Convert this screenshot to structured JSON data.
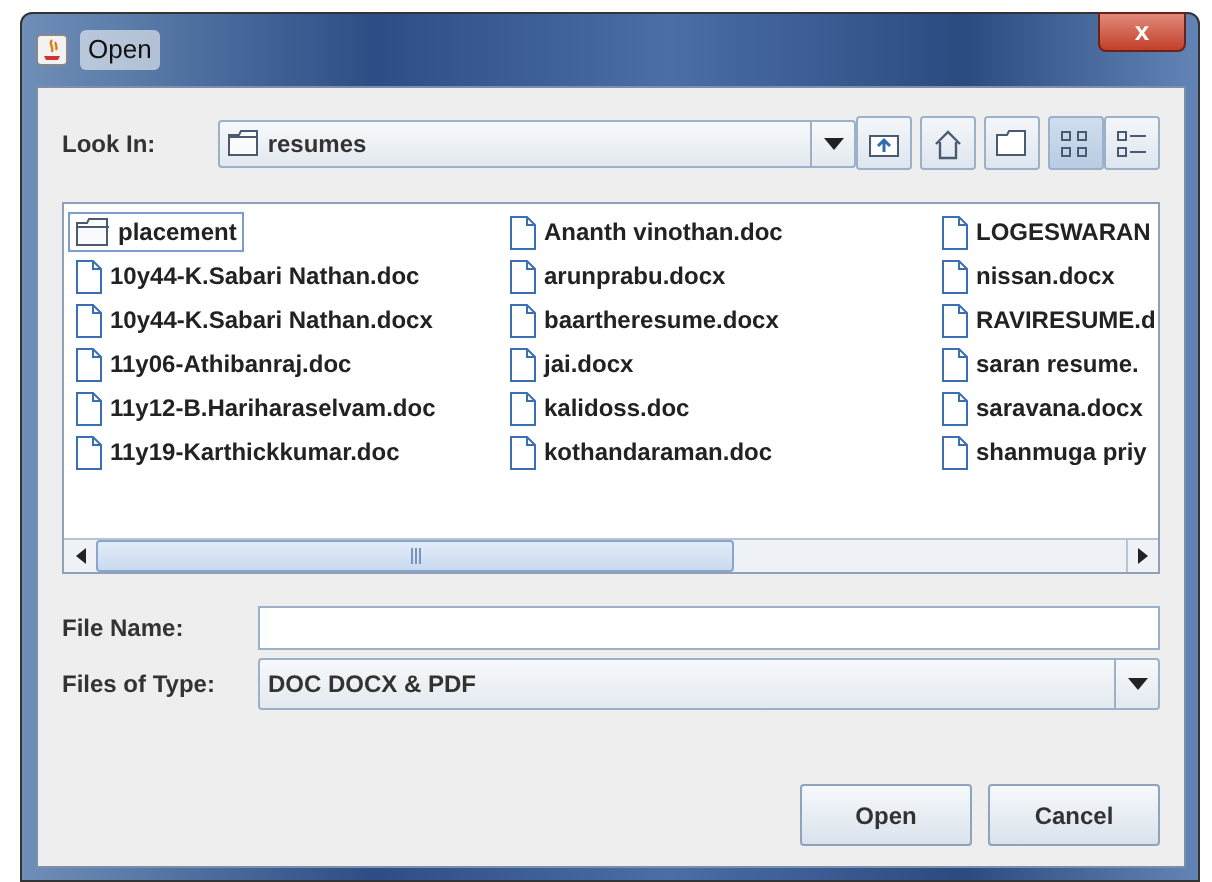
{
  "window": {
    "title": "Open",
    "close": "x"
  },
  "look_in": {
    "label": "Look In:",
    "value": "resumes"
  },
  "view_buttons": [
    {
      "selected": true
    },
    {
      "selected": false
    }
  ],
  "files": [
    {
      "name": "placement",
      "kind": "folder",
      "selected": true
    },
    {
      "name": "10y44-K.Sabari Nathan.doc",
      "kind": "file",
      "selected": false
    },
    {
      "name": "10y44-K.Sabari Nathan.docx",
      "kind": "file",
      "selected": false
    },
    {
      "name": "11y06-Athibanraj.doc",
      "kind": "file",
      "selected": false
    },
    {
      "name": "11y12-B.Hariharaselvam.doc",
      "kind": "file",
      "selected": false
    },
    {
      "name": "11y19-Karthickkumar.doc",
      "kind": "file",
      "selected": false
    },
    {
      "name": "Ananth vinothan.doc",
      "kind": "file",
      "selected": false
    },
    {
      "name": "arunprabu.docx",
      "kind": "file",
      "selected": false
    },
    {
      "name": "baartheresume.docx",
      "kind": "file",
      "selected": false
    },
    {
      "name": "jai.docx",
      "kind": "file",
      "selected": false
    },
    {
      "name": "kalidoss.doc",
      "kind": "file",
      "selected": false
    },
    {
      "name": "kothandaraman.doc",
      "kind": "file",
      "selected": false
    },
    {
      "name": "LOGESWARAN",
      "kind": "file",
      "selected": false
    },
    {
      "name": "nissan.docx",
      "kind": "file",
      "selected": false
    },
    {
      "name": "RAVIRESUME.d",
      "kind": "file",
      "selected": false
    },
    {
      "name": "saran resume.",
      "kind": "file",
      "selected": false
    },
    {
      "name": "saravana.docx",
      "kind": "file",
      "selected": false
    },
    {
      "name": "shanmuga priy",
      "kind": "file",
      "selected": false
    }
  ],
  "file_name": {
    "label": "File Name:"
  },
  "file_type": {
    "label": "Files of Type:",
    "value": "DOC DOCX & PDF"
  },
  "buttons": [
    "Open",
    "Cancel"
  ]
}
